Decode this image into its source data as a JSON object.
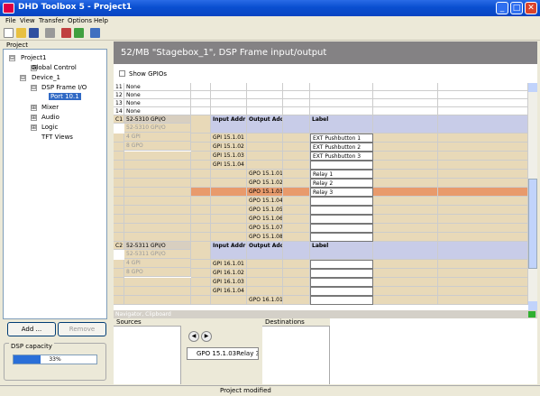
{
  "window": {
    "title": "DHD Toolbox 5 - Project1",
    "min": "_",
    "max": "□",
    "close": "✕"
  },
  "menu": [
    "File",
    "View",
    "Transfer",
    "Options",
    "Help"
  ],
  "project": {
    "header": "Project",
    "tree": [
      {
        "label": "Project1",
        "expander": "⊟"
      },
      {
        "label": "Global Control",
        "expander": "⊞"
      },
      {
        "label": "Device_1",
        "expander": "⊟"
      },
      {
        "label": "DSP Frame I/O",
        "expander": "⊟"
      },
      {
        "label": "Port 10.1",
        "expander": ""
      },
      {
        "label": "Mixer",
        "expander": "⊞"
      },
      {
        "label": "Audio",
        "expander": "⊞"
      },
      {
        "label": "Logic",
        "expander": "⊞"
      },
      {
        "label": "TFT Views",
        "expander": ""
      }
    ],
    "add": "Add ...",
    "remove": "Remove",
    "dsp_label": "DSP capacity",
    "dsp_percent": "33%",
    "dsp_value": 0.33
  },
  "page": {
    "title": "52/MB \"Stagebox_1\", DSP Frame input/output",
    "show_gpios": "Show GPIOs"
  },
  "rows_top": [
    {
      "n": "11",
      "v": "None"
    },
    {
      "n": "12",
      "v": "None"
    },
    {
      "n": "13",
      "v": "None"
    },
    {
      "n": "14",
      "v": "None"
    }
  ],
  "c1": {
    "id": "C1",
    "name": "52-5310 GPI/O",
    "sub1": "52-5310 GPI/O",
    "sub2": "4 GPI",
    "sub3": "8 GPO",
    "headers": {
      "in": "Input Addr",
      "out": "Output Add",
      "label": "Label"
    },
    "rows": [
      [
        "GPI 15.1.01",
        "",
        "EXT Pushbutton 1"
      ],
      [
        "GPI 15.1.02",
        "",
        "EXT Pushbutton 2"
      ],
      [
        "GPI 15.1.03",
        "",
        "EXT Pushbutton 3"
      ],
      [
        "GPI 15.1.04",
        "",
        ""
      ],
      [
        "",
        "GPO 15.1.01",
        "Relay 1"
      ],
      [
        "",
        "GPO 15.1.02",
        "Relay 2"
      ],
      [
        "",
        "GPO 15.1.03",
        "Relay 3"
      ],
      [
        "",
        "GPO 15.1.04",
        ""
      ],
      [
        "",
        "GPO 15.1.05",
        ""
      ],
      [
        "",
        "GPO 15.1.06",
        ""
      ],
      [
        "",
        "GPO 15.1.07",
        ""
      ],
      [
        "",
        "GPO 15.1.08",
        ""
      ]
    ]
  },
  "c2": {
    "id": "C2",
    "name": "52-5311 GPI/O",
    "sub1": "52-5311 GPI/O",
    "sub2": "4 GPI",
    "sub3": "8 GPO",
    "headers": {
      "in": "Input Addr",
      "out": "Output Add",
      "label": "Label"
    },
    "rows": [
      [
        "GPI 16.1.01",
        "",
        ""
      ],
      [
        "GPI 16.1.02",
        "",
        ""
      ],
      [
        "GPI 16.1.03",
        "",
        ""
      ],
      [
        "GPI 16.1.04",
        "",
        ""
      ],
      [
        "",
        "GPO 16.1.01",
        ""
      ]
    ]
  },
  "navigator": {
    "title": "Navigator, Clipboard",
    "sources": "Sources",
    "destinations": "Destinations",
    "clip_item": "GPO 15.1.03Relay 3",
    "arrow_left": "◀",
    "arrow_right": "▶"
  },
  "status": "Project modified"
}
